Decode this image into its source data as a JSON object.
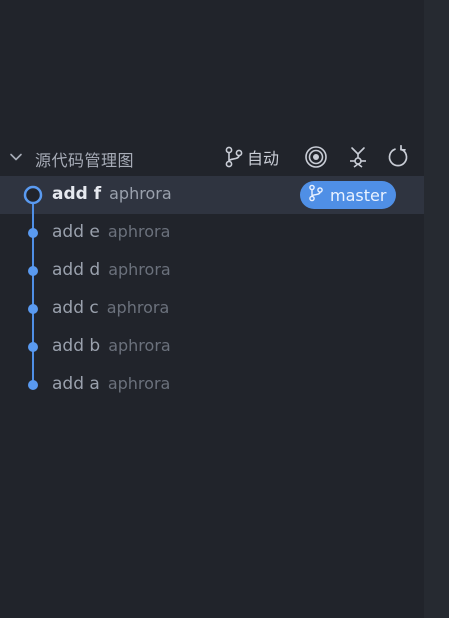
{
  "header": {
    "title": "源代码管理图",
    "auto_label": "自动"
  },
  "icons": {
    "collapse": "chevron-down-icon",
    "branch": "git-branch-icon",
    "target": "target-icon",
    "fetch": "fetch-icon",
    "refresh": "refresh-icon"
  },
  "commits": [
    {
      "message": "add f",
      "author": "aphrora",
      "branch": "master",
      "selected": true
    },
    {
      "message": "add e",
      "author": "aphrora"
    },
    {
      "message": "add d",
      "author": "aphrora"
    },
    {
      "message": "add c",
      "author": "aphrora"
    },
    {
      "message": "add b",
      "author": "aphrora"
    },
    {
      "message": "add a",
      "author": "aphrora"
    }
  ],
  "colors": {
    "accent": "#4f8fe6",
    "background": "#21242b",
    "selected_row": "#2f3440"
  }
}
